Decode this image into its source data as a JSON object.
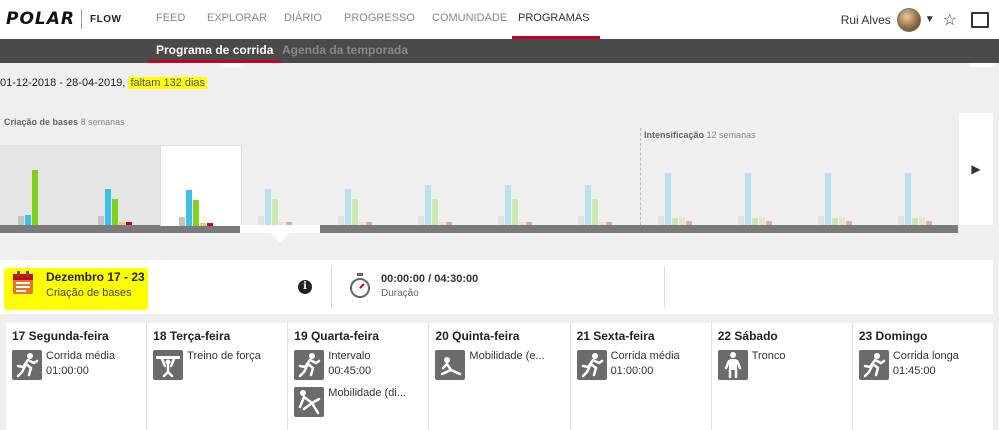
{
  "brand": {
    "logo": "POLAR",
    "product": "FLOW"
  },
  "nav": [
    {
      "label": "FEED",
      "active": false
    },
    {
      "label": "EXPLORAR",
      "active": false
    },
    {
      "label": "DIÁRIO",
      "active": false
    },
    {
      "label": "PROGRESSO",
      "active": false
    },
    {
      "label": "COMUNIDADE",
      "active": false
    },
    {
      "label": "PROGRAMAS",
      "active": true
    }
  ],
  "user": {
    "name": "Rui Alves",
    "caret_icon": "caret-down-icon",
    "star_icon": "star-icon",
    "messages_icon": "messages-icon"
  },
  "subnav": [
    {
      "label": "Programa de corrida",
      "active": true
    },
    {
      "label": "Agenda da temporada",
      "active": false
    }
  ],
  "program": {
    "date_range": "01-12-2018 - 28-04-2019,",
    "remaining": "faltam 132 dias"
  },
  "phases": [
    {
      "name": "Criação de bases",
      "weeks": "8 semanas"
    },
    {
      "name": "Intensificação",
      "weeks": "12 semanas"
    }
  ],
  "weeks_chart": {
    "series_colors": {
      "gray": "#c3c3c3",
      "blue": "#3ec1e8",
      "green": "#7ed321",
      "yellow": "#f5c36b",
      "red": "#d0021b"
    },
    "weeks": [
      {
        "state": "past",
        "values": [
          9,
          10,
          55,
          0,
          0
        ]
      },
      {
        "state": "past",
        "values": [
          9,
          36,
          26,
          3,
          3
        ]
      },
      {
        "state": "selected",
        "values": [
          9,
          36,
          26,
          3,
          3
        ]
      },
      {
        "state": "future",
        "values": [
          9,
          36,
          26,
          3,
          3
        ]
      },
      {
        "state": "future",
        "values": [
          9,
          36,
          26,
          3,
          3
        ]
      },
      {
        "state": "future",
        "values": [
          9,
          40,
          26,
          3,
          3
        ]
      },
      {
        "state": "future",
        "values": [
          9,
          40,
          26,
          3,
          3
        ]
      },
      {
        "state": "future",
        "values": [
          9,
          40,
          26,
          3,
          3
        ]
      },
      {
        "state": "future",
        "values": [
          9,
          52,
          7,
          8,
          4
        ]
      },
      {
        "state": "future",
        "values": [
          9,
          52,
          7,
          8,
          4
        ]
      },
      {
        "state": "future",
        "values": [
          9,
          52,
          7,
          8,
          4
        ]
      },
      {
        "state": "future",
        "values": [
          9,
          52,
          7,
          8,
          4
        ]
      }
    ],
    "next_icon": "next-arrow-icon"
  },
  "week_summary": {
    "title": "Dezembro 17 - 23",
    "phase": "Criação de bases",
    "calendar_icon": "calendar-icon",
    "info_icon": "info-icon",
    "stopwatch_icon": "stopwatch-icon",
    "duration_value": "00:00:00 / 04:30:00",
    "duration_label": "Duração"
  },
  "days": [
    {
      "label": "17 Segunda-feira",
      "workouts": [
        {
          "title": "Corrida média",
          "duration": "01:00:00",
          "icon": "running-icon"
        }
      ]
    },
    {
      "label": "18 Terça-feira",
      "workouts": [
        {
          "title": "Treino de força",
          "duration": "",
          "icon": "strength-icon"
        }
      ]
    },
    {
      "label": "19 Quarta-feira",
      "workouts": [
        {
          "title": "Intervalo",
          "duration": "00:45:00",
          "icon": "running-icon"
        },
        {
          "title": "Mobilidade (di...",
          "duration": "",
          "icon": "mobility-icon"
        }
      ]
    },
    {
      "label": "20 Quinta-feira",
      "workouts": [
        {
          "title": "Mobilidade (e...",
          "duration": "",
          "icon": "stretching-icon"
        }
      ]
    },
    {
      "label": "21 Sexta-feira",
      "workouts": [
        {
          "title": "Corrida média",
          "duration": "01:00:00",
          "icon": "running-icon"
        }
      ]
    },
    {
      "label": "22 Sábado",
      "workouts": [
        {
          "title": "Tronco",
          "duration": "",
          "icon": "core-icon"
        }
      ]
    },
    {
      "label": "23 Domingo",
      "workouts": [
        {
          "title": "Corrida longa",
          "duration": "01:45:00",
          "icon": "running-icon"
        }
      ]
    }
  ]
}
